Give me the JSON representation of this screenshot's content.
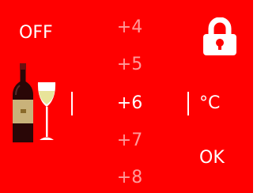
{
  "power_label": "OFF",
  "lock_icon": "padlock-icon",
  "wine_icon": "wine-bottle-and-glass-icon",
  "temperature_options": [
    "+4",
    "+5",
    "+6",
    "+7",
    "+8"
  ],
  "selected_temperature": "+6",
  "unit_label": "°C",
  "confirm_label": "OK",
  "colors": {
    "background": "#ff0000",
    "text": "#ffffff",
    "muted_text": "#ff9a9a"
  }
}
